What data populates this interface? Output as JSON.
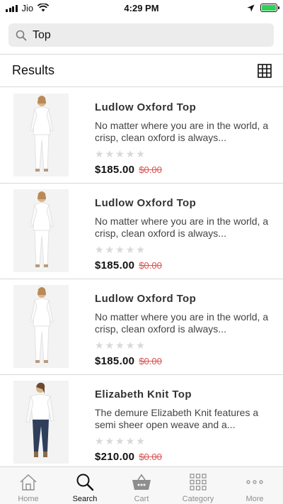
{
  "status_bar": {
    "carrier": "Jio",
    "time": "4:29 PM",
    "battery_color": "#2fd158"
  },
  "search": {
    "value": "Top",
    "placeholder": "Search",
    "icon": "search-icon"
  },
  "results": {
    "title": "Results",
    "view_toggle_icon": "grid-icon",
    "items": [
      {
        "name": "Ludlow Oxford Top",
        "description": "No matter where you are in the world, a crisp, clean oxford is always...",
        "rating": 0,
        "price": "$185.00",
        "old_price": "$0.00"
      },
      {
        "name": "Ludlow Oxford Top",
        "description": "No matter where you are in the world, a crisp, clean oxford is always...",
        "rating": 0,
        "price": "$185.00",
        "old_price": "$0.00"
      },
      {
        "name": "Ludlow Oxford Top",
        "description": "No matter where you are in the world, a crisp, clean oxford is always...",
        "rating": 0,
        "price": "$185.00",
        "old_price": "$0.00"
      },
      {
        "name": "Elizabeth Knit Top",
        "description": "The demure Elizabeth Knit features a semi sheer open weave and a...",
        "rating": 0,
        "price": "$210.00",
        "old_price": "$0.00"
      }
    ]
  },
  "tab_bar": {
    "active": "Search",
    "tabs": [
      {
        "label": "Home",
        "icon": "home-icon"
      },
      {
        "label": "Search",
        "icon": "search-icon"
      },
      {
        "label": "Cart",
        "icon": "basket-icon"
      },
      {
        "label": "Category",
        "icon": "grid-dots-icon"
      },
      {
        "label": "More",
        "icon": "more-icon"
      }
    ]
  }
}
